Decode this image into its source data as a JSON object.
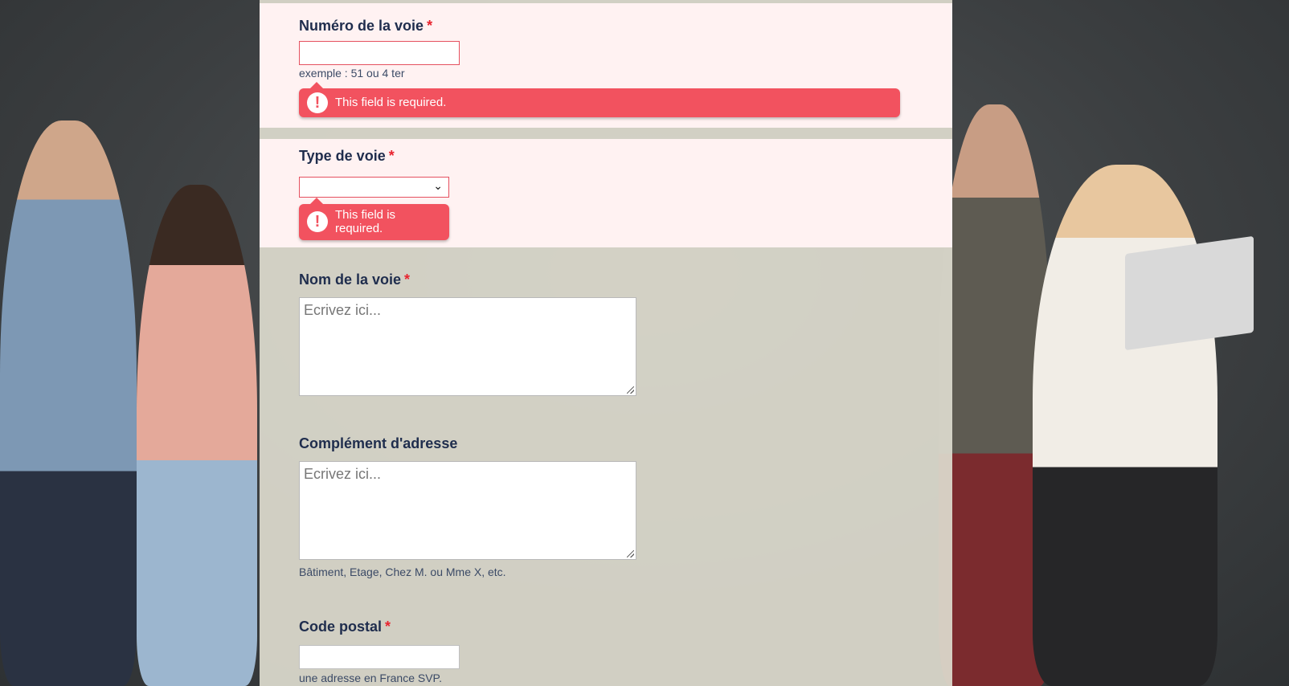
{
  "form": {
    "street_number": {
      "label": "Numéro de la voie",
      "required_mark": "*",
      "value": "",
      "hint": "exemple : 51 ou 4 ter",
      "error": "This field is required."
    },
    "street_type": {
      "label": "Type de voie",
      "required_mark": "*",
      "selected": "",
      "error_line1": "This field is",
      "error_line2": "required."
    },
    "street_name": {
      "label": "Nom de la voie",
      "required_mark": "*",
      "placeholder": "Ecrivez ici..."
    },
    "address_complement": {
      "label": "Complément d'adresse",
      "placeholder": "Ecrivez ici...",
      "hint": "Bâtiment, Etage, Chez M. ou Mme X, etc."
    },
    "postal_code": {
      "label": "Code postal",
      "required_mark": "*",
      "value": "",
      "hint": "une adresse en France SVP."
    }
  },
  "icons": {
    "error_icon": "!",
    "chevron_down_icon": "⌄"
  },
  "colors": {
    "error_red": "#f2525f",
    "label_navy": "#1f2d4d",
    "error_section_bg": "#fff2f2"
  }
}
